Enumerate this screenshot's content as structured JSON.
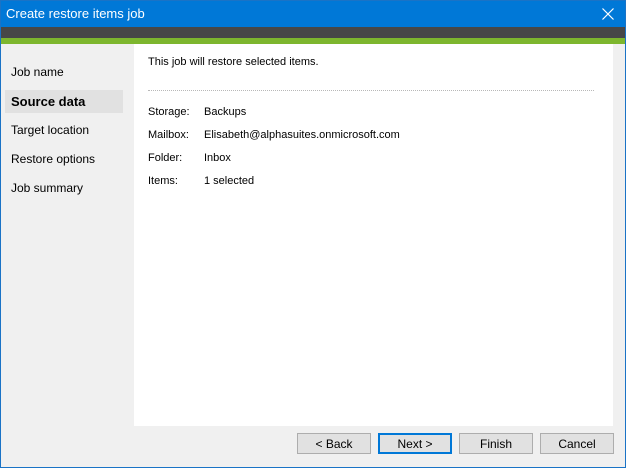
{
  "window": {
    "title": "Create restore items job",
    "close_icon": "close-icon"
  },
  "sidebar": {
    "items": [
      {
        "label": "Job name",
        "active": false
      },
      {
        "label": "Source data",
        "active": true
      },
      {
        "label": "Target location",
        "active": false
      },
      {
        "label": "Restore options",
        "active": false
      },
      {
        "label": "Job summary",
        "active": false
      }
    ]
  },
  "main": {
    "intro": "This job will restore selected items.",
    "fields": [
      {
        "label": "Storage:",
        "value": "Backups"
      },
      {
        "label": "Mailbox:",
        "value": "Elisabeth@alphasuites.onmicrosoft.com"
      },
      {
        "label": "Folder:",
        "value": "Inbox"
      },
      {
        "label": "Items:",
        "value": "1 selected"
      }
    ]
  },
  "buttons": {
    "back": "< Back",
    "next": "Next >",
    "finish": "Finish",
    "cancel": "Cancel"
  },
  "colors": {
    "titlebar": "#0078d7",
    "banner_dark": "#474747",
    "banner_green": "#7db62e"
  }
}
